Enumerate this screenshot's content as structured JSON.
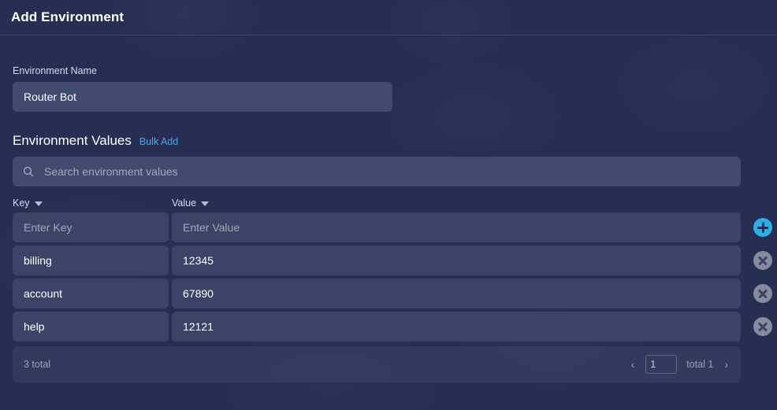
{
  "header": {
    "title": "Add Environment"
  },
  "form": {
    "name_label": "Environment Name",
    "name_value": "Router Bot",
    "name_placeholder": "Environment Name"
  },
  "values_section": {
    "title": "Environment Values",
    "bulk_add_label": "Bulk Add",
    "search_placeholder": "Search environment values",
    "search_value": "",
    "search_icon": "search-icon",
    "columns": [
      {
        "label": "Key",
        "sort_icon": "chevron-down-icon"
      },
      {
        "label": "Value",
        "sort_icon": "chevron-down-icon"
      }
    ],
    "new_row": {
      "key_placeholder": "Enter Key",
      "key_value": "",
      "value_placeholder": "Enter Value",
      "value_value": "",
      "add_icon": "plus-circle-icon"
    },
    "rows": [
      {
        "key": "billing",
        "value": "12345",
        "delete_icon": "close-circle-icon"
      },
      {
        "key": "account",
        "value": "67890",
        "delete_icon": "close-circle-icon"
      },
      {
        "key": "help",
        "value": "12121",
        "delete_icon": "close-circle-icon"
      }
    ],
    "pager": {
      "total_label": "3 total",
      "prev_icon": "‹",
      "next_icon": "›",
      "page_value": "1",
      "pages_label": "total 1"
    }
  },
  "colors": {
    "background": "#262f52",
    "input_background": "#414b6e",
    "cell_background": "#3b4466",
    "accent_link": "#3fa9f5",
    "add_button": "#29b0e8",
    "delete_button": "#878b9c",
    "divider": "#3b4468"
  }
}
